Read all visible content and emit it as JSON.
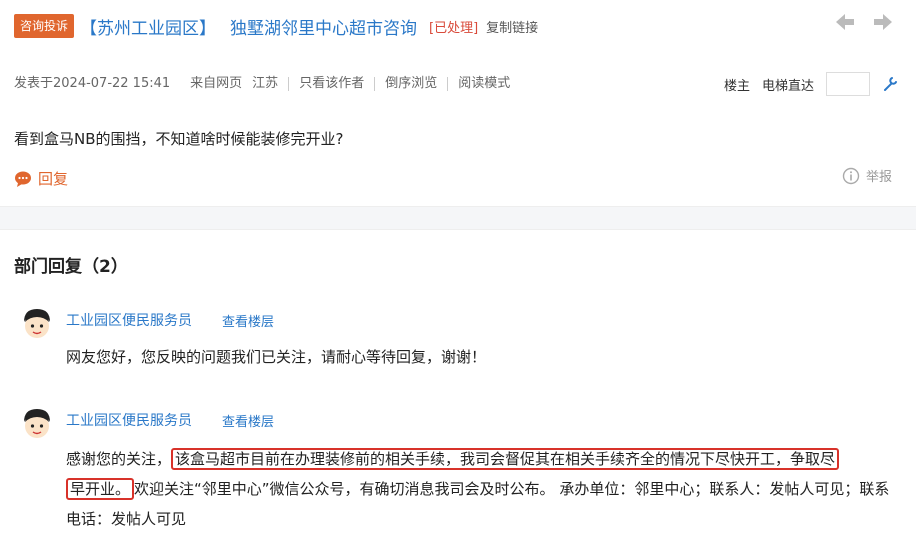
{
  "header": {
    "badge": "咨询投诉",
    "region": "【苏州工业园区】",
    "title": "独墅湖邻里中心超市咨询",
    "status": "[已处理]",
    "copy_link": "复制链接"
  },
  "meta": {
    "posted": "发表于2024-07-22 15:41",
    "source": "来自网页",
    "location": "江苏",
    "only_author": "只看该作者",
    "reverse": "倒序浏览",
    "read_mode": "阅读模式",
    "owner": "楼主",
    "elevator": "电梯直达"
  },
  "post": {
    "body": "看到盒马NB的围挡，不知道啥时候能装修完开业?",
    "reply_label": "回复",
    "report_label": "举报"
  },
  "section": {
    "title": "部门回复（2）"
  },
  "replies": [
    {
      "author": "工业园区便民服务员",
      "view_floor": "查看楼层",
      "text": "网友您好，您反映的问题我们已关注，请耐心等待回复，谢谢！"
    },
    {
      "author": "工业园区便民服务员",
      "view_floor": "查看楼层",
      "text_pre": "感谢您的关注，",
      "text_hl1": "该盒马超市目前在办理装修前的相关手续，我司会督促其在相关手续齐全的情况下尽快开工，争取尽",
      "text_hl2": "早开业。",
      "text_post": "欢迎关注“邻里中心”微信公众号，有确切消息我司会及时公布。 承办单位：邻里中心；联系人：发帖人可见；联系电话：发帖人可见"
    }
  ],
  "colors": {
    "accent": "#e0662e",
    "link": "#2a78c8",
    "status": "#d94a3a",
    "highlight": "#d8322a"
  }
}
